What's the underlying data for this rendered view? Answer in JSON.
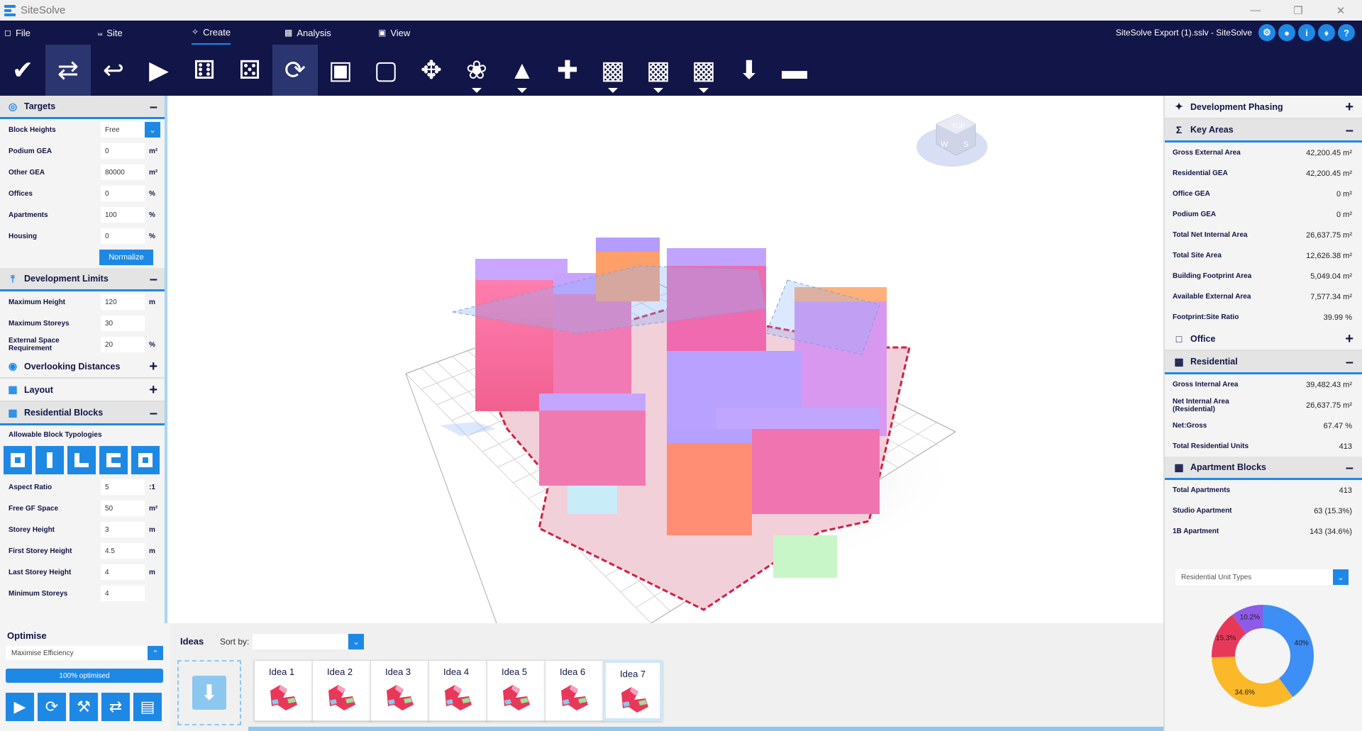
{
  "app": {
    "name": "SiteSolve",
    "document_title": "SiteSolve Export (1).sslv - SiteSolve"
  },
  "menu": [
    {
      "label": "File",
      "icon": "square-icon"
    },
    {
      "label": "Site",
      "icon": "site-icon"
    },
    {
      "label": "Create",
      "icon": "create-icon",
      "active": true
    },
    {
      "label": "Analysis",
      "icon": "analysis-icon"
    },
    {
      "label": "View",
      "icon": "view-icon"
    }
  ],
  "header_icons": [
    "settings-icon",
    "user-icon",
    "info-icon",
    "bell-icon",
    "help-icon"
  ],
  "toolbar": [
    {
      "icon": "check-icon"
    },
    {
      "icon": "optimize-shuffle-icon",
      "active": true
    },
    {
      "icon": "undo-arrow-icon"
    },
    {
      "icon": "play-icon"
    },
    {
      "icon": "dice-icon"
    },
    {
      "icon": "dice-pair-icon"
    },
    {
      "icon": "lock-refresh-icon",
      "active": true
    },
    {
      "icon": "lock-icon"
    },
    {
      "icon": "unlock-icon"
    },
    {
      "icon": "network-icon"
    },
    {
      "icon": "broadcast-icon",
      "dropdown": true
    },
    {
      "icon": "buildings-icon",
      "dropdown": true
    },
    {
      "icon": "plus-icon"
    },
    {
      "icon": "box-edit-icon",
      "dropdown": true
    },
    {
      "icon": "box-pen-icon",
      "dropdown": true
    },
    {
      "icon": "box-cut-icon",
      "dropdown": true
    },
    {
      "icon": "download-icon"
    },
    {
      "icon": "minus-icon"
    }
  ],
  "targets": {
    "title": "Targets",
    "rows": [
      {
        "label": "Block Heights",
        "value": "Free",
        "unit": "",
        "dropdown": true
      },
      {
        "label": "Podium GEA",
        "value": "0",
        "unit": "m²"
      },
      {
        "label": "Other GEA",
        "value": "80000",
        "unit": "m²"
      },
      {
        "label": "Offices",
        "value": "0",
        "unit": "%"
      },
      {
        "label": "Apartments",
        "value": "100",
        "unit": "%"
      },
      {
        "label": "Housing",
        "value": "0",
        "unit": "%"
      }
    ],
    "normalize_label": "Normalize"
  },
  "dev_limits": {
    "title": "Development Limits",
    "rows": [
      {
        "label": "Maximum Height",
        "value": "120",
        "unit": "m"
      },
      {
        "label": "Maximum Storeys",
        "value": "30",
        "unit": ""
      },
      {
        "label": "External Space Requirement",
        "value": "20",
        "unit": "%"
      }
    ]
  },
  "overlooking": {
    "title": "Overlooking Distances"
  },
  "layout": {
    "title": "Layout"
  },
  "res_blocks": {
    "title": "Residential Blocks",
    "typologies_label": "Allowable Block Typologies",
    "rows": [
      {
        "label": "Aspect Ratio",
        "value": "5",
        "unit": ":1"
      },
      {
        "label": "Free GF Space",
        "value": "50",
        "unit": "m²"
      },
      {
        "label": "Storey Height",
        "value": "3",
        "unit": "m"
      },
      {
        "label": "First Storey Height",
        "value": "4.5",
        "unit": "m"
      },
      {
        "label": "Last Storey Height",
        "value": "4",
        "unit": "m"
      },
      {
        "label": "Minimum Storeys",
        "value": "4",
        "unit": ""
      }
    ]
  },
  "optimise": {
    "title": "Optimise",
    "mode": "Maximise Efficiency",
    "progress_label": "100% optimised",
    "progress": 100
  },
  "ideas": {
    "title": "Ideas",
    "sort_label": "Sort by:",
    "items": [
      "Idea 1",
      "Idea 2",
      "Idea 3",
      "Idea 4",
      "Idea 5",
      "Idea 6",
      "Idea 7"
    ],
    "selected": 6
  },
  "right": {
    "dev_phasing": "Development Phasing",
    "key_areas": {
      "title": "Key Areas",
      "rows": [
        {
          "label": "Gross External Area",
          "value": "42,200.45 m²"
        },
        {
          "label": "Residential GEA",
          "value": "42,200.45 m²"
        },
        {
          "label": "Office GEA",
          "value": "0 m²"
        },
        {
          "label": "Podium GEA",
          "value": "0 m²"
        },
        {
          "label": "Total Net Internal Area",
          "value": "26,637.75 m²"
        },
        {
          "label": "Total Site Area",
          "value": "12,626.38 m²"
        },
        {
          "label": "Building Footprint Area",
          "value": "5,049.04 m²"
        },
        {
          "label": "Available External Area",
          "value": "7,577.34 m²"
        },
        {
          "label": "Footprint:Site Ratio",
          "value": "39.99 %"
        }
      ]
    },
    "office": "Office",
    "residential": {
      "title": "Residential",
      "rows": [
        {
          "label": "Gross Internal Area",
          "value": "39,482.43 m²"
        },
        {
          "label": "Net Internal Area (Residential)",
          "value": "26,637.75 m²"
        },
        {
          "label": "Net:Gross",
          "value": "67.47 %"
        },
        {
          "label": "Total Residential Units",
          "value": "413"
        }
      ]
    },
    "apartments": {
      "title": "Apartment Blocks",
      "rows": [
        {
          "label": "Total Apartments",
          "value": "413"
        },
        {
          "label": "Studio Apartment",
          "value": "63 (15.3%)"
        },
        {
          "label": "1B Apartment",
          "value": "143 (34.6%)"
        }
      ]
    },
    "unit_types_select": "Residential Unit Types"
  },
  "chart_data": {
    "type": "pie",
    "title": "",
    "slices": [
      {
        "label": "40%",
        "value": 40,
        "color": "#3d8ef5"
      },
      {
        "label": "34.6%",
        "value": 34.6,
        "color": "#fbb829"
      },
      {
        "label": "15.3%",
        "value": 15.3,
        "color": "#e8385a"
      },
      {
        "label": "10.2%",
        "value": 10.2,
        "color": "#8e5ae8"
      }
    ]
  },
  "colors": {
    "navy": "#121547",
    "accent": "#1e88e5"
  }
}
